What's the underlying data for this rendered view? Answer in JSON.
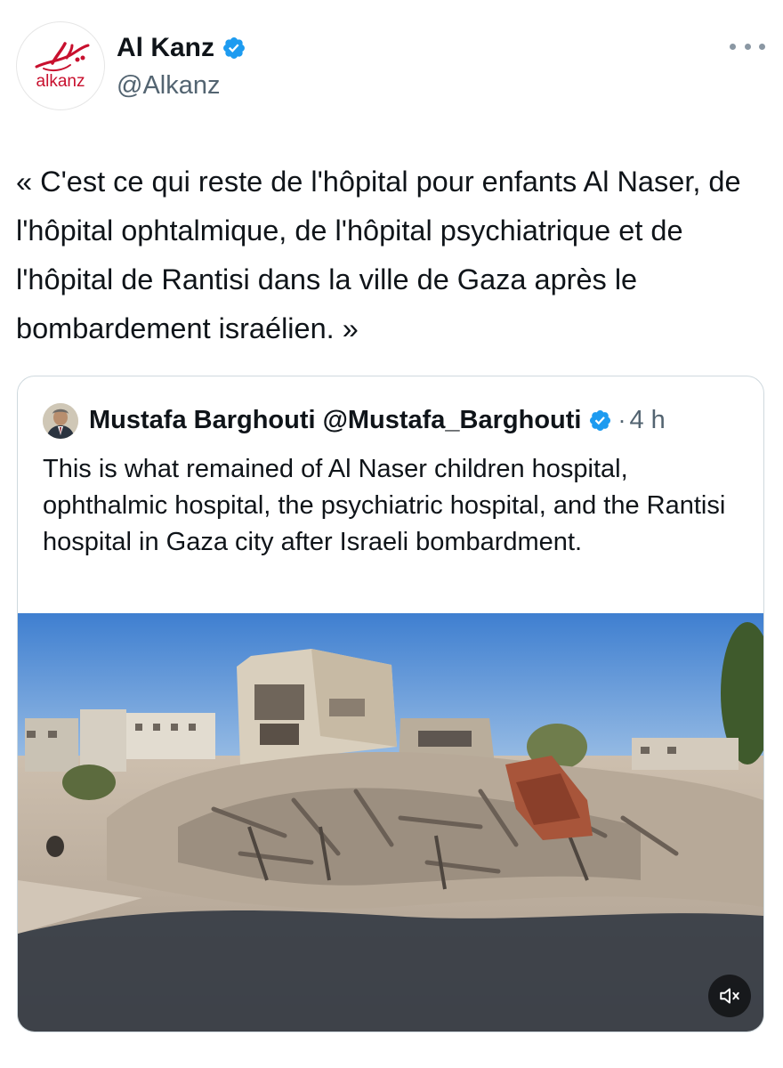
{
  "author": {
    "display_name": "Al Kanz",
    "handle": "@Alkanz",
    "avatar_logo_text": "alkanz",
    "verified": true
  },
  "tweet": {
    "text": "« C'est ce qui reste de l'hôpital pour enfants Al Naser, de l'hôpital ophtalmique, de l'hôpital psychiatrique et de l'hôpital de Rantisi dans la ville de Gaza après le bombardement israélien. »"
  },
  "quoted_tweet": {
    "author_name": "Mustafa Barghouti",
    "author_handle": "@Mustafa_Barghouti",
    "verified": true,
    "separator": "·",
    "time": "4 h",
    "text": "This is what remained of Al Naser children hospital, ophthalmic hospital, the psychiatric hospital, and the Rantisi hospital in Gaza city after Israeli bombardment.",
    "media": {
      "type": "video",
      "subject": "rubble-of-destroyed-buildings",
      "muted": true
    }
  },
  "icons": {
    "more": "more-horizontal-icon",
    "verified": "verified-badge-icon",
    "mute": "volume-muted-icon"
  },
  "colors": {
    "verified_blue": "#1d9bf0",
    "secondary_text": "#536471",
    "border": "#cfd9de",
    "logo_red": "#c8102e"
  }
}
